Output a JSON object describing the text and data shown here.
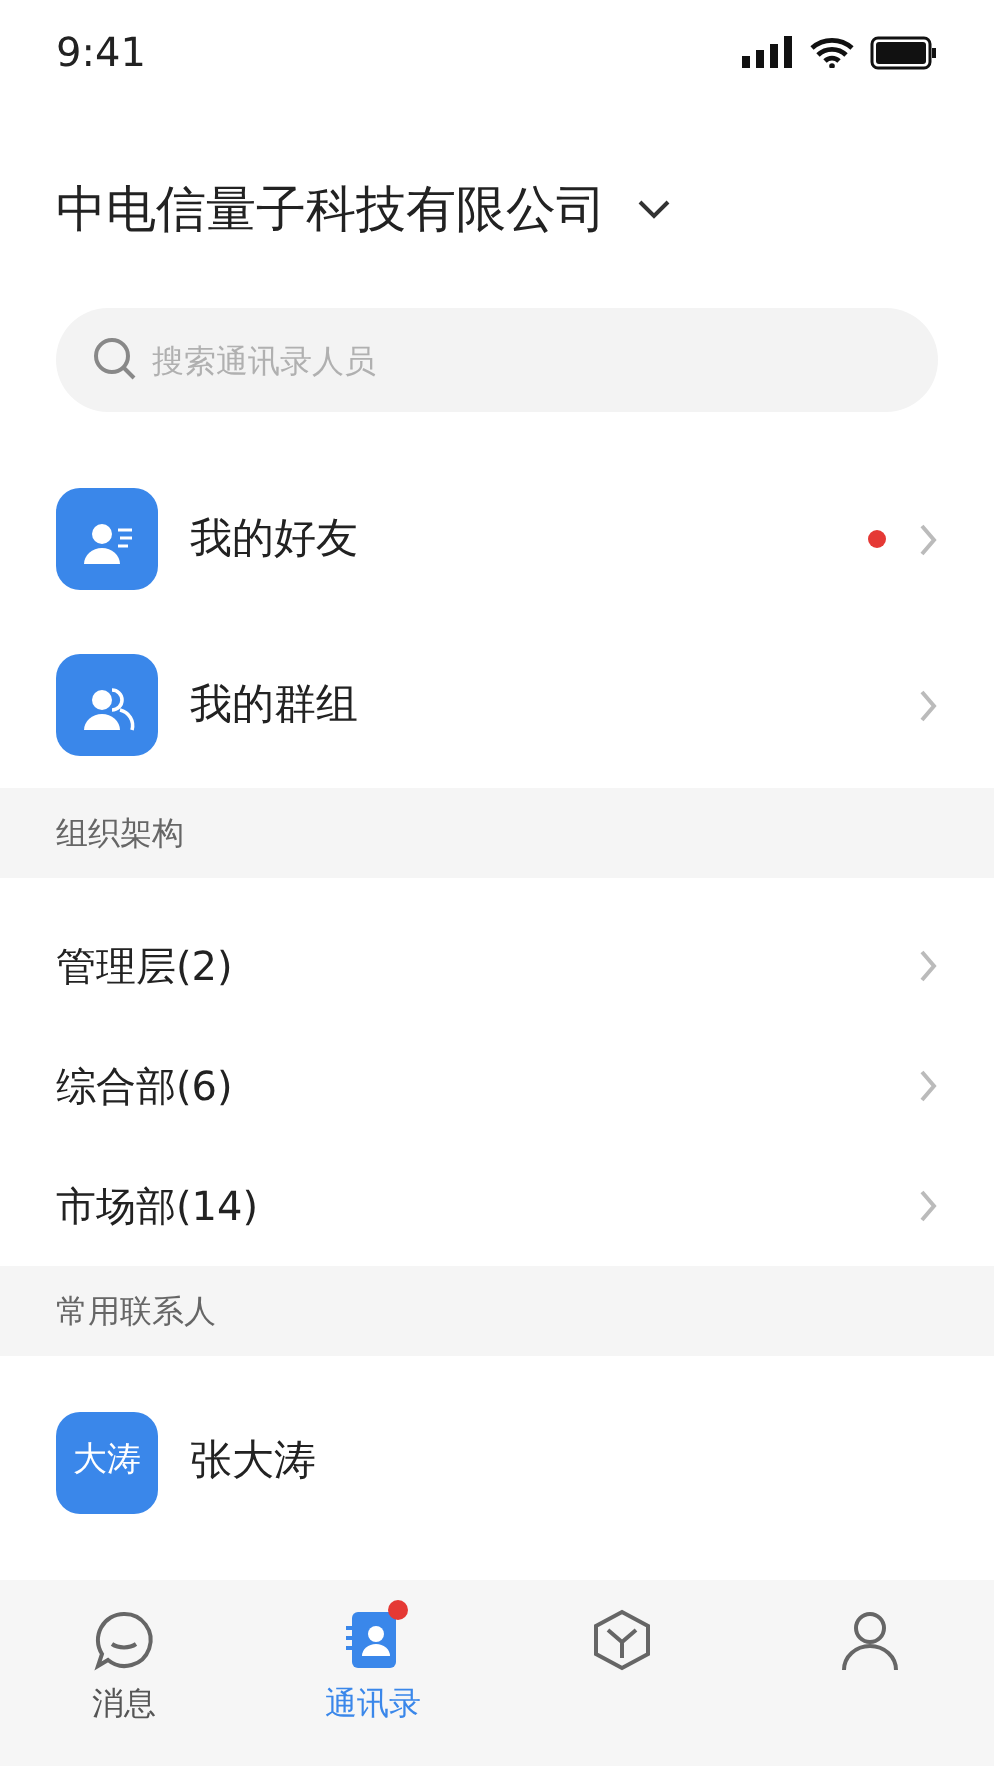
{
  "status_bar": {
    "time": "9:41"
  },
  "header": {
    "title": "中电信量子科技有限公司"
  },
  "search": {
    "placeholder": "搜索通讯录人员"
  },
  "shortcuts": [
    {
      "kind": "friends",
      "label": "我的好友",
      "unread": true
    },
    {
      "kind": "groups",
      "label": "我的群组",
      "unread": false
    }
  ],
  "sections": [
    {
      "title": "组织架构",
      "items": [
        {
          "label": "管理层(2)"
        },
        {
          "label": "综合部(6)"
        },
        {
          "label": "市场部(14)"
        }
      ]
    },
    {
      "title": "常用联系人",
      "contacts": [
        {
          "avatar": "大涛",
          "name": "张大涛"
        }
      ]
    }
  ],
  "tab_bar": [
    {
      "kind": "message",
      "label": "消息",
      "selected": false,
      "badge": false
    },
    {
      "kind": "contacts",
      "label": "通讯录",
      "selected": true,
      "badge": true
    },
    {
      "kind": "workbench",
      "selected": false,
      "badge": false
    },
    {
      "kind": "profile",
      "selected": false,
      "badge": false
    }
  ]
}
